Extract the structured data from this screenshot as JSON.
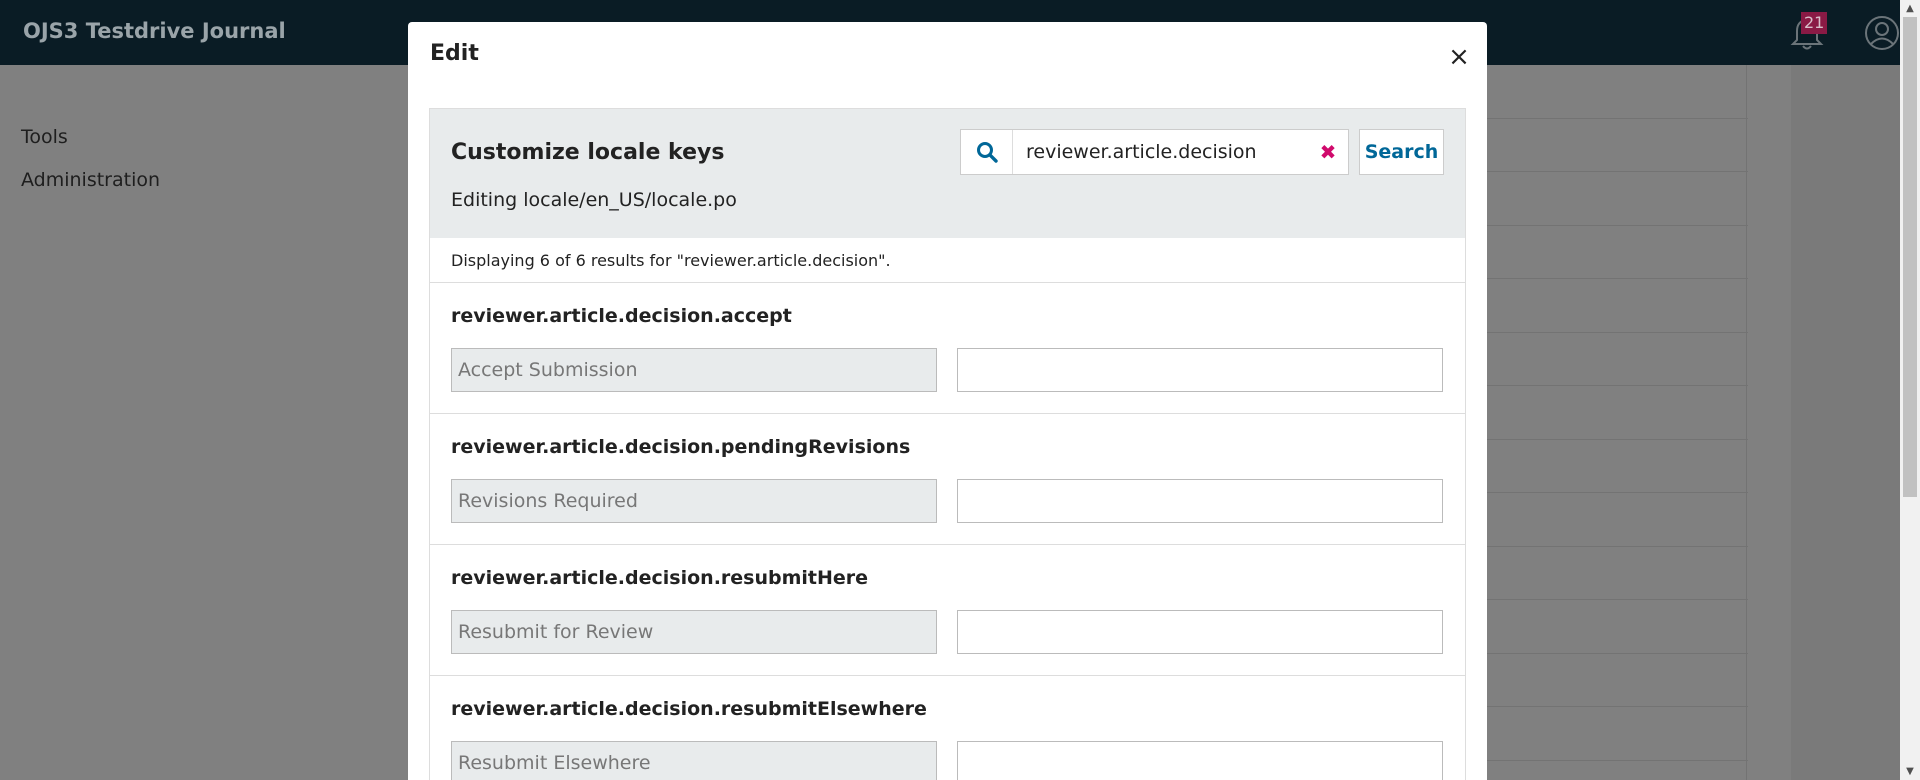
{
  "app": {
    "title": "OJS3 Testdrive Journal",
    "notification_count": "21"
  },
  "sidebar": {
    "items": [
      {
        "label": "Tools"
      },
      {
        "label": "Administration"
      }
    ]
  },
  "modal": {
    "title": "Edit",
    "close_label": "×",
    "panel": {
      "heading": "Customize locale keys",
      "subheading": "Editing locale/en_US/locale.po",
      "search": {
        "value": "reviewer.article.decision",
        "clear_label": "✖",
        "button_label": "Search"
      },
      "results_summary": "Displaying 6 of 6 results for \"reviewer.article.decision\".",
      "entries": [
        {
          "key": "reviewer.article.decision.accept",
          "default": "Accept Submission",
          "value": ""
        },
        {
          "key": "reviewer.article.decision.pendingRevisions",
          "default": "Revisions Required",
          "value": ""
        },
        {
          "key": "reviewer.article.decision.resubmitHere",
          "default": "Resubmit for Review",
          "value": ""
        },
        {
          "key": "reviewer.article.decision.resubmitElsewhere",
          "default": "Resubmit Elsewhere",
          "value": ""
        }
      ]
    }
  },
  "colors": {
    "topbar": "#0a1c25",
    "accent": "#006798",
    "clear": "#d00a6c",
    "badge": "#8a1a45"
  },
  "icons": {
    "search": "search-icon",
    "clear": "clear-icon",
    "close": "close-icon",
    "bell": "bell-icon",
    "user": "user-icon"
  }
}
